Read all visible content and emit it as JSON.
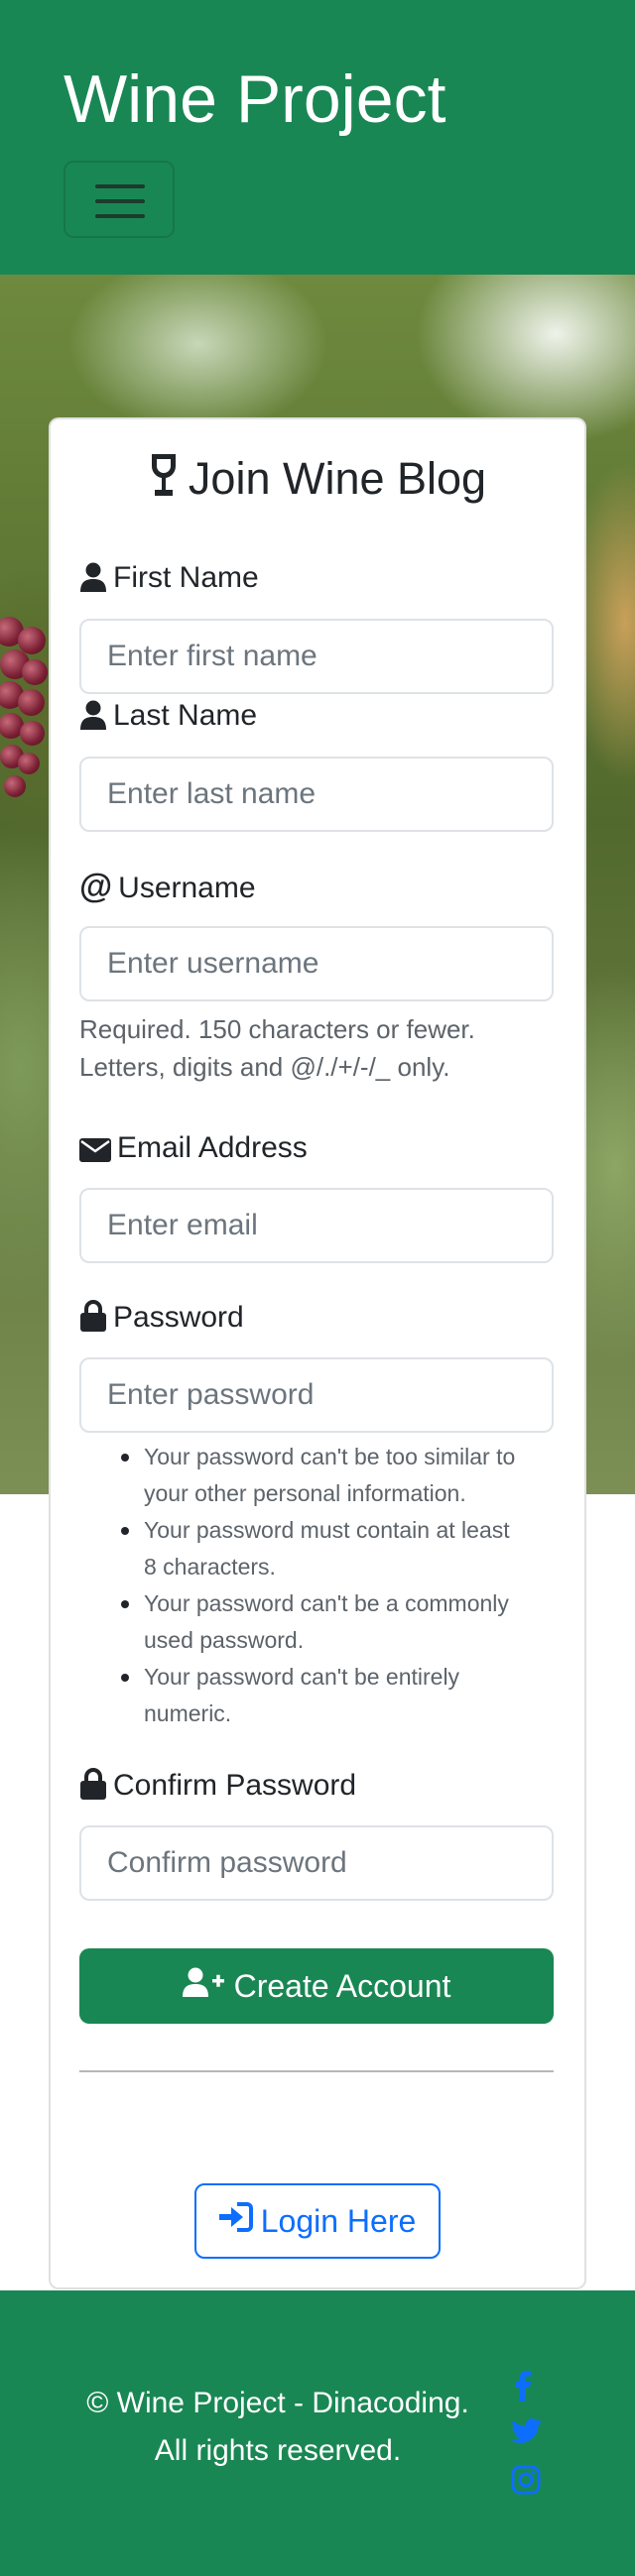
{
  "header": {
    "brand": "Wine Project",
    "menu_toggle": "menu-toggle"
  },
  "form": {
    "title": "Join Wine Blog",
    "fields": {
      "first_name": {
        "label": "First Name",
        "placeholder": "Enter first name",
        "value": ""
      },
      "last_name": {
        "label": "Last Name",
        "placeholder": "Enter last name",
        "value": ""
      },
      "username": {
        "label": "Username",
        "placeholder": "Enter username",
        "value": "",
        "help": [
          "Required. 150 characters or fewer.",
          "Letters, digits and @/./+/-/_ only."
        ]
      },
      "email": {
        "label": "Email Address",
        "placeholder": "Enter email",
        "value": ""
      },
      "password": {
        "label": "Password",
        "placeholder": "Enter password",
        "value": ""
      },
      "confirm_password": {
        "label": "Confirm Password",
        "placeholder": "Confirm password",
        "value": ""
      }
    },
    "password_rules": [
      [
        "Your password can't be too similar to",
        "your other personal information."
      ],
      [
        "Your password must contain at least",
        "8 characters."
      ],
      [
        "Your password can't be a commonly",
        "used password."
      ],
      [
        "Your password can't be entirely",
        "numeric."
      ]
    ],
    "submit_label": "Create Account",
    "login_label": "Login Here"
  },
  "footer": {
    "line1": "© Wine Project - Dinacoding.",
    "line2": "All rights reserved.",
    "social_icons": [
      "facebook-icon",
      "twitter-icon",
      "instagram-icon"
    ]
  },
  "colors": {
    "primary_green": "#198754",
    "link_blue": "#0d6efd",
    "text": "#212529",
    "muted": "#5c636a"
  }
}
